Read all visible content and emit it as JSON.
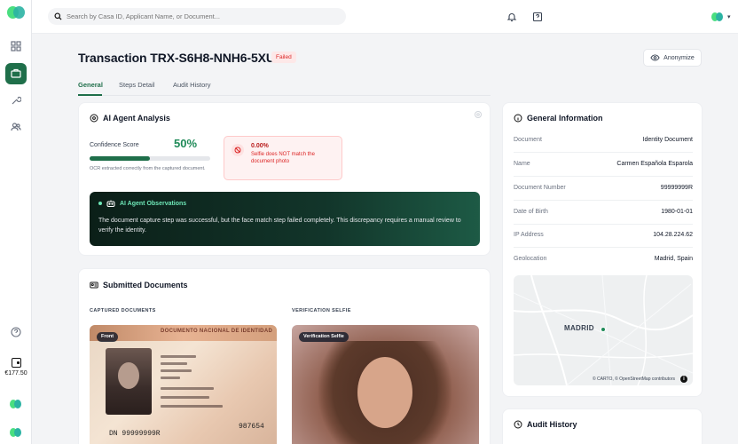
{
  "topbar": {
    "search_placeholder": "Search by Casa ID, Applicant Name, or Document..."
  },
  "sidebar": {
    "credit": "€177.50"
  },
  "header": {
    "title": "Transaction TRX-S6H8-NNH6-5XUW",
    "status": "Failed",
    "anonymize_label": "Anonymize",
    "tabs": [
      "General",
      "Steps Detail",
      "Audit History"
    ]
  },
  "analysis": {
    "title": "AI Agent Analysis",
    "confidence_label": "Confidence Score",
    "confidence_value": "50%",
    "confidence_fraction": 0.5,
    "ocr_note": "OCR extracted correctly from the captured document.",
    "alert_value": "0.00%",
    "alert_message": "Selfie does NOT match the document photo",
    "observations_title": "AI Agent Observations",
    "observations_text": "The document capture step was successful, but the face match step failed completely. This discrepancy requires a manual review to verify the identity."
  },
  "documents": {
    "title": "Submitted Documents",
    "captured_label": "CAPTURED DOCUMENTS",
    "selfie_label": "VERIFICATION SELFIE",
    "front_pill": "Front",
    "selfie_pill": "Verification Selfie",
    "id_band": "DOCUMENTO NACIONAL DE IDENTIDAD",
    "id_number": "DN 99999999R",
    "id_number2": "987654"
  },
  "general_info": {
    "title": "General Information",
    "rows": [
      {
        "k": "Document",
        "v": "Identity Document"
      },
      {
        "k": "Name",
        "v": "Carmen Española Esparola"
      },
      {
        "k": "Document Number",
        "v": "99999999R"
      },
      {
        "k": "Date of Birth",
        "v": "1980-01-01"
      },
      {
        "k": "IP Address",
        "v": "104.28.224.62"
      },
      {
        "k": "Geolocation",
        "v": "Madrid, Spain"
      }
    ],
    "map_city": "MADRID",
    "map_credit": "© CARTO, © OpenStreetMap contributors"
  },
  "audit": {
    "title": "Audit History"
  }
}
